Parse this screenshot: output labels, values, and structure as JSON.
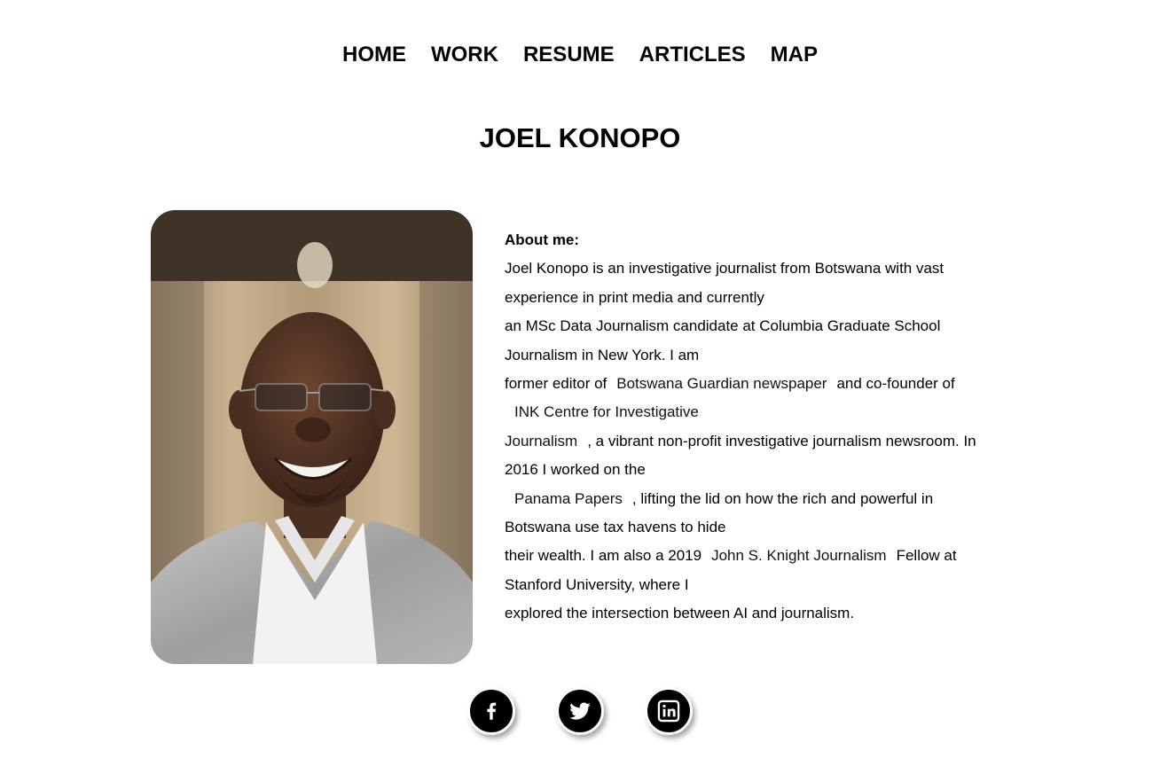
{
  "nav": {
    "items": [
      {
        "label": "HOME"
      },
      {
        "label": "WORK"
      },
      {
        "label": "RESUME"
      },
      {
        "label": "ARTICLES"
      },
      {
        "label": "MAP"
      }
    ]
  },
  "page": {
    "title": "JOEL KONOPO"
  },
  "about": {
    "heading": "About me:",
    "l1": "Joel Konopo is an investigative journalist from Botswana with vast",
    "l2": "experience in print media and currently",
    "l3": "an MSc Data Journalism candidate at Columbia Graduate School",
    "l4": "Journalism in New York. I am",
    "l5a": "former editor of",
    "link_bg": "Botswana Guardian newspaper",
    "l5b": "and co-founder of",
    "link_ink": "INK Centre for Investigative",
    "link_ink2": "Journalism",
    "l7b": ", a vibrant non-profit investigative journalism newsroom. In",
    "l8": "2016 I worked on the",
    "link_pp": "Panama Papers",
    "l9b": ", lifting the lid on how the rich and powerful in",
    "l10": "Botswana use tax havens to hide",
    "l11a": "their wealth. I am also a 2019",
    "link_jsk": "John S. Knight Journalism",
    "l11b": "Fellow at",
    "l12": "Stanford University, where I",
    "l13": "explored the intersection between AI and journalism."
  },
  "social": [
    {
      "icon": "facebook-icon"
    },
    {
      "icon": "twitter-icon"
    },
    {
      "icon": "linkedin-icon"
    }
  ]
}
